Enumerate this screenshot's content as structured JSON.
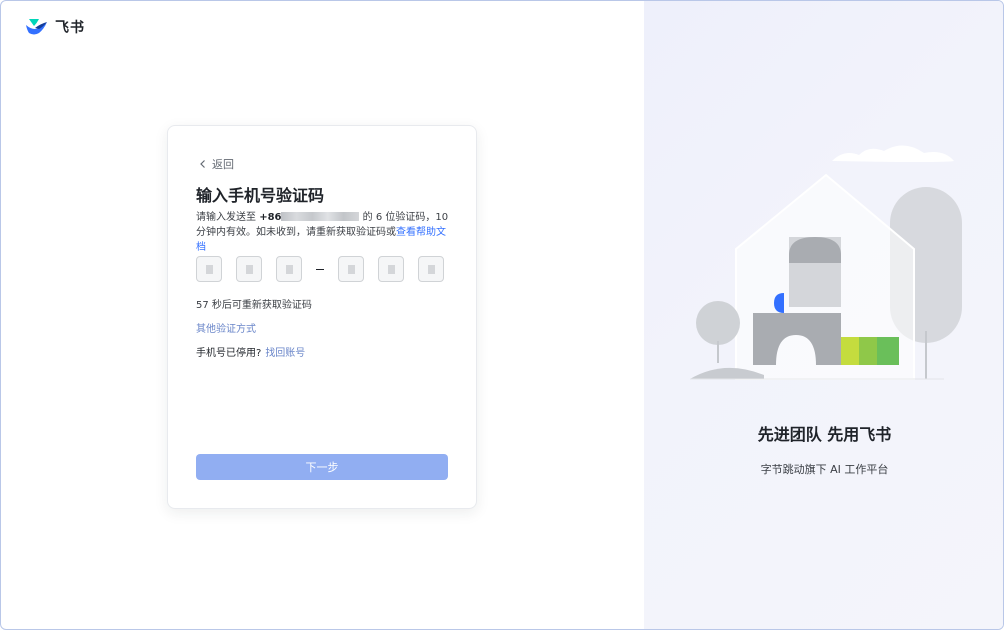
{
  "brand": {
    "name": "飞书"
  },
  "card": {
    "back_label": "返回",
    "title": "输入手机号验证码",
    "desc_prefix": "请输入发送至 ",
    "phone_prefix": "+86",
    "desc_mid": " 的 6 位验证码，10 分钟内有效。如未收到，请重新获取验证码或",
    "help_link": "查看帮助文档",
    "countdown": "57 秒后可重新获取验证码",
    "other_methods": "其他验证方式",
    "phone_disabled_text": "手机号已停用?",
    "recover_link": "找回账号",
    "next_button": "下一步"
  },
  "right_panel": {
    "slogan": "先进团队 先用飞书",
    "sub_slogan": "字节跳动旗下 AI 工作平台"
  },
  "colors": {
    "accent": "#3370ff",
    "button_disabled": "#91aef2",
    "brand_green": "#33d6c0",
    "brand_blue": "#3370ff",
    "illus_lime": "#c4dc3e",
    "illus_green": "#6abf5a"
  }
}
